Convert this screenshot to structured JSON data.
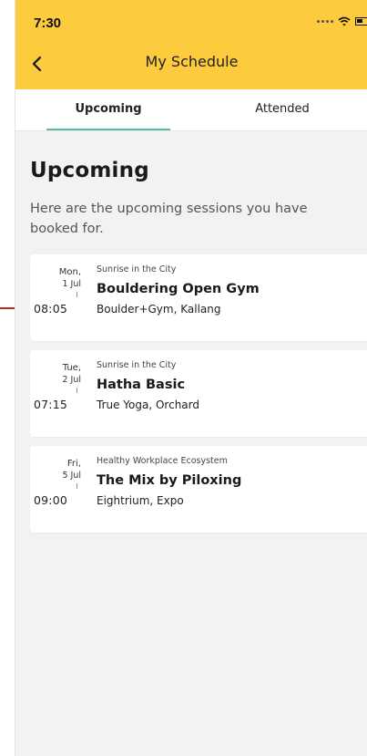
{
  "status": {
    "time": "7:30"
  },
  "header": {
    "title": "My Schedule",
    "back_icon": "chevron-left-icon"
  },
  "tabs": [
    {
      "label": "Upcoming",
      "active": true
    },
    {
      "label": "Attended",
      "active": false
    }
  ],
  "main": {
    "title": "Upcoming",
    "description": "Here are the upcoming sessions you have booked for."
  },
  "sessions": [
    {
      "day": "Mon,",
      "date": "1 Jul",
      "time": "08:05",
      "category": "Sunrise in the City",
      "name": "Bouldering Open Gym",
      "venue": "Boulder+Gym, Kallang"
    },
    {
      "day": "Tue,",
      "date": "2 Jul",
      "time": "07:15",
      "category": "Sunrise in the City",
      "name": "Hatha Basic",
      "venue": "True Yoga, Orchard"
    },
    {
      "day": "Fri,",
      "date": "5 Jul",
      "time": "09:00",
      "category": "Healthy Workplace Ecosystem",
      "name": "The Mix by Piloxing",
      "venue": "Eightrium, Expo"
    }
  ],
  "colors": {
    "header_bg": "#fccb3e",
    "tab_indicator": "#5cb8a8",
    "annotation_arrow": "#c0281e",
    "page_bg": "#f2f2f2"
  }
}
